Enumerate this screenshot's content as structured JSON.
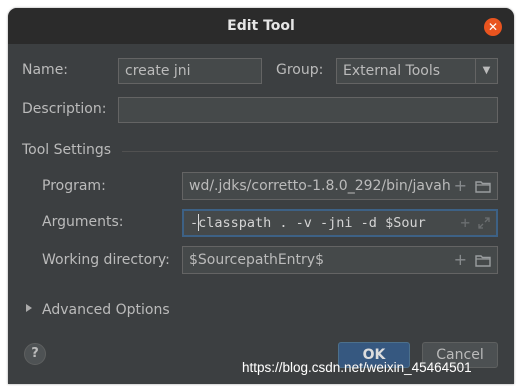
{
  "window": {
    "title": "Edit Tool"
  },
  "form": {
    "name_label": "Name:",
    "name_value": "create jni",
    "group_label": "Group:",
    "group_value": "External Tools",
    "description_label": "Description:",
    "description_value": ""
  },
  "tool_settings": {
    "section_label": "Tool Settings",
    "program_label": "Program:",
    "program_value": "wd/.jdks/corretto-1.8.0_292/bin/javah",
    "arguments_label": "Arguments:",
    "arguments_value": "-classpath . -v -jni -d $Sour",
    "working_dir_label": "Working directory:",
    "working_dir_value": "$SourcepathEntry$"
  },
  "advanced": {
    "label": "Advanced Options"
  },
  "buttons": {
    "help": "?",
    "ok": "OK",
    "cancel": "Cancel"
  },
  "watermark": "https://blog.csdn.net/weixin_45464501",
  "colors": {
    "dialog_bg": "#3c3f41",
    "title_bg": "#2b2b2b",
    "close": "#e9541f",
    "ok_button": "#365880",
    "focus_border": "#3d6185"
  },
  "icons": [
    "close-icon",
    "add-icon",
    "folder-icon",
    "expand-icon",
    "chevron-down-icon",
    "triangle-right-icon"
  ]
}
